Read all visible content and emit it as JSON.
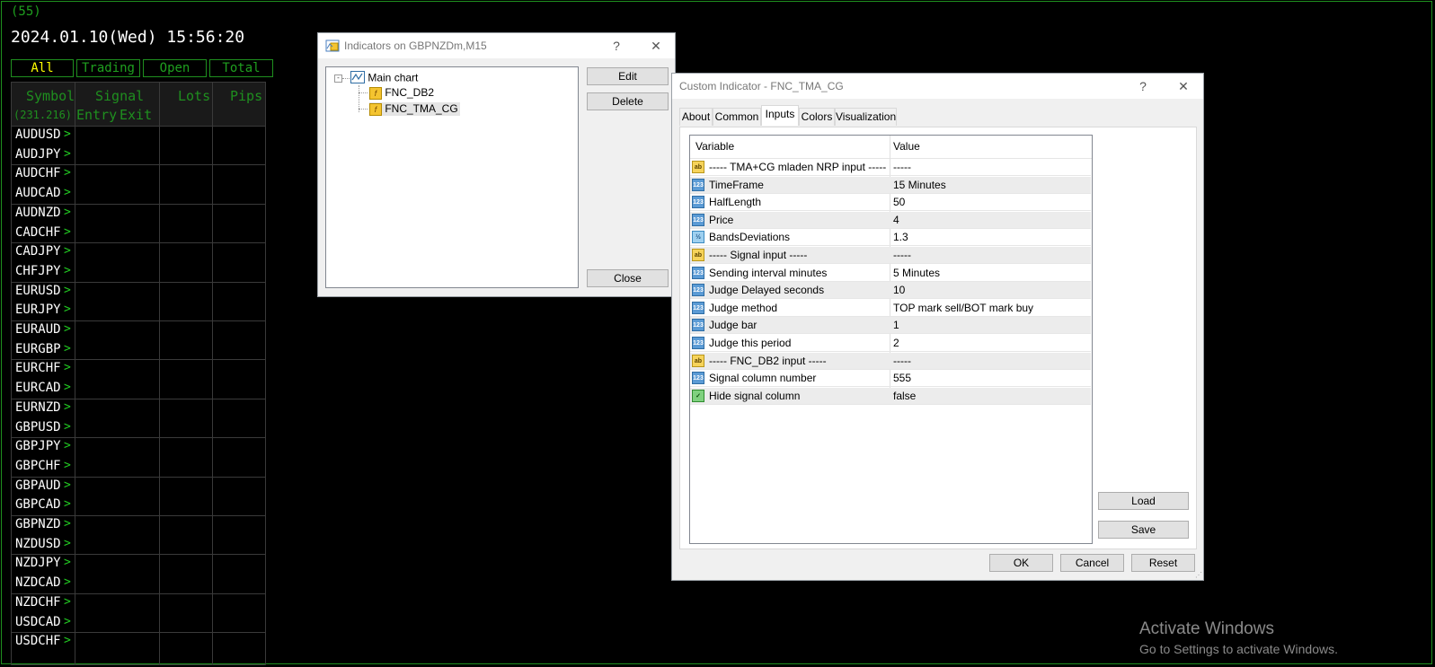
{
  "panel": {
    "count": "(55)",
    "datetime": "2024.01.10(Wed) 15:56:20",
    "filters": [
      "All",
      "Trading",
      "Open",
      "Total"
    ],
    "headers": {
      "symbol": "Symbol",
      "symbol_count": "(231.216)",
      "signal": "Signal",
      "entry": "Entry",
      "exit": "Exit",
      "lots": "Lots",
      "pips": "Pips"
    },
    "symbols": [
      "AUDUSD",
      "AUDJPY",
      "AUDCHF",
      "AUDCAD",
      "AUDNZD",
      "CADCHF",
      "CADJPY",
      "CHFJPY",
      "EURUSD",
      "EURJPY",
      "EURAUD",
      "EURGBP",
      "EURCHF",
      "EURCAD",
      "EURNZD",
      "GBPUSD",
      "GBPJPY",
      "GBPCHF",
      "GBPAUD",
      "GBPCAD",
      "GBPNZD",
      "NZDUSD",
      "NZDJPY",
      "NZDCAD",
      "NZDCHF",
      "USDCAD",
      "USDCHF"
    ],
    "chevron": ">"
  },
  "indicators_window": {
    "title": "Indicators on GBPNZDm,M15",
    "help": "?",
    "close_x": "✕",
    "tree": {
      "root": "Main chart",
      "children": [
        "FNC_DB2",
        "FNC_TMA_CG"
      ]
    },
    "buttons": {
      "edit": "Edit",
      "delete": "Delete",
      "close": "Close"
    }
  },
  "custom_indicator_window": {
    "title": "Custom Indicator - FNC_TMA_CG",
    "help": "?",
    "close_x": "✕",
    "tabs": [
      "About",
      "Common",
      "Inputs",
      "Colors",
      "Visualization"
    ],
    "active_tab": "Inputs",
    "columns": {
      "variable": "Variable",
      "value": "Value"
    },
    "rows": [
      {
        "type": "ab",
        "icon": "ab",
        "variable": "----- TMA+CG mladen NRP input -----",
        "value": "-----"
      },
      {
        "type": "n123",
        "icon": "123",
        "variable": "TimeFrame",
        "value": "15 Minutes"
      },
      {
        "type": "n123",
        "icon": "123",
        "variable": "HalfLength",
        "value": "50"
      },
      {
        "type": "n123",
        "icon": "123",
        "variable": "Price",
        "value": "4"
      },
      {
        "type": "frac",
        "icon": "½",
        "variable": "BandsDeviations",
        "value": "1.3"
      },
      {
        "type": "ab",
        "icon": "ab",
        "variable": "----- Signal input -----",
        "value": "-----"
      },
      {
        "type": "n123",
        "icon": "123",
        "variable": "Sending interval minutes",
        "value": "5 Minutes"
      },
      {
        "type": "n123",
        "icon": "123",
        "variable": "Judge Delayed seconds",
        "value": "10"
      },
      {
        "type": "n123",
        "icon": "123",
        "variable": "Judge method",
        "value": "TOP mark sell/BOT mark buy"
      },
      {
        "type": "n123",
        "icon": "123",
        "variable": "Judge bar",
        "value": "1"
      },
      {
        "type": "n123",
        "icon": "123",
        "variable": "Judge this period",
        "value": "2"
      },
      {
        "type": "ab",
        "icon": "ab",
        "variable": "----- FNC_DB2 input -----",
        "value": "-----"
      },
      {
        "type": "n123",
        "icon": "123",
        "variable": "Signal column number",
        "value": "555"
      },
      {
        "type": "bool",
        "icon": "✓",
        "variable": "Hide signal column",
        "value": "false"
      }
    ],
    "buttons": {
      "load": "Load",
      "save": "Save",
      "ok": "OK",
      "cancel": "Cancel",
      "reset": "Reset"
    }
  },
  "watermark": {
    "line1": "Activate Windows",
    "line2": "Go to Settings to activate Windows."
  }
}
